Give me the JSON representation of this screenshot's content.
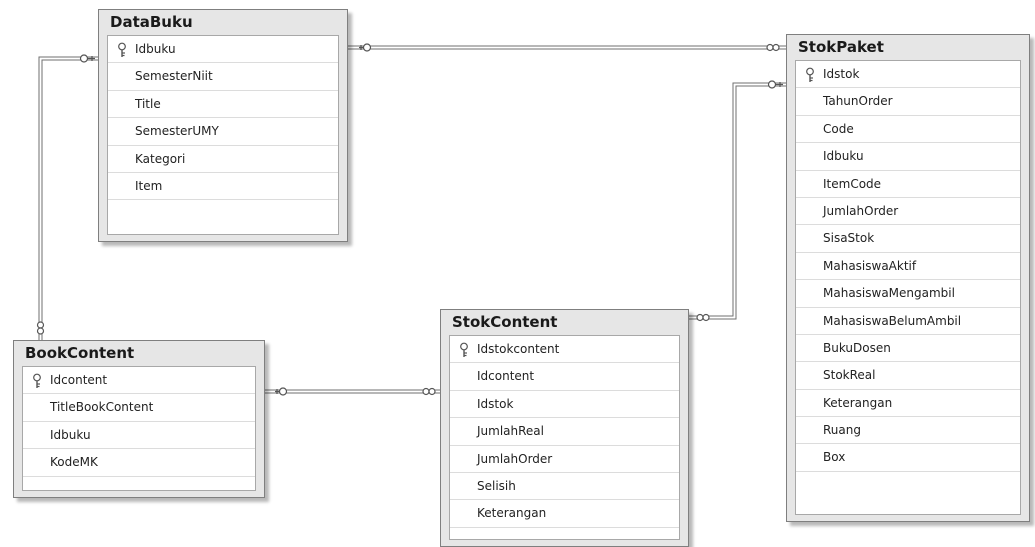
{
  "tables": {
    "databuku": {
      "title": "DataBuku",
      "columns": [
        "Idbuku",
        "SemesterNiit",
        "Title",
        "SemesterUMY",
        "Kategori",
        "Item"
      ],
      "primary_key": "Idbuku"
    },
    "stokpaket": {
      "title": "StokPaket",
      "columns": [
        "Idstok",
        "TahunOrder",
        "Code",
        "Idbuku",
        "ItemCode",
        "JumlahOrder",
        "SisaStok",
        "MahasiswaAktif",
        "MahasiswaMengambil",
        "MahasiswaBelumAmbil",
        "BukuDosen",
        "StokReal",
        "Keterangan",
        "Ruang",
        "Box"
      ],
      "primary_key": "Idstok"
    },
    "bookcontent": {
      "title": "BookContent",
      "columns": [
        "Idcontent",
        "TitleBookContent",
        "Idbuku",
        "KodeMK"
      ],
      "primary_key": "Idcontent"
    },
    "stokcontent": {
      "title": "StokContent",
      "columns": [
        "Idstokcontent",
        "Idcontent",
        "Idstok",
        "JumlahReal",
        "JumlahOrder",
        "Selisih",
        "Keterangan"
      ],
      "primary_key": "Idstokcontent"
    }
  },
  "relationships": [
    {
      "from": "databuku",
      "to": "stokpaket",
      "one_end": "databuku",
      "many_end": "stokpaket"
    },
    {
      "from": "databuku",
      "to": "bookcontent",
      "one_end": "databuku",
      "many_end": "bookcontent"
    },
    {
      "from": "bookcontent",
      "to": "stokcontent",
      "one_end": "bookcontent",
      "many_end": "stokcontent"
    },
    {
      "from": "stokpaket",
      "to": "stokcontent",
      "one_end": "stokpaket",
      "many_end": "stokcontent"
    }
  ],
  "icons": {
    "primary_key": "key-icon",
    "one_end": "key-end-icon",
    "many_end": "infinity-end-icon"
  },
  "colors": {
    "connector": "#6f6f6f",
    "table_header": "#e6e6e6",
    "table_border": "#7f7f7f"
  }
}
